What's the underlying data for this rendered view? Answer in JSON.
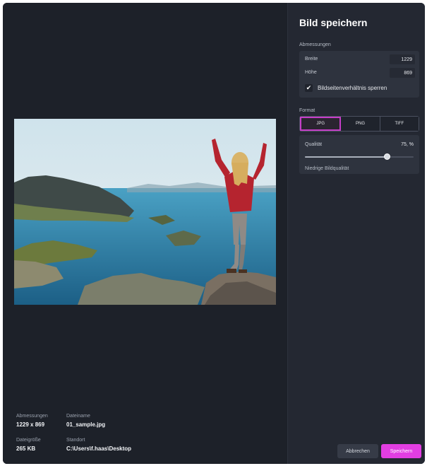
{
  "preview": {
    "image_alt": "Woman with raised arms standing on a rock above a coastal fjord landscape",
    "meta": {
      "dimensions_label": "Abmessungen",
      "dimensions_value": "1229 x 869",
      "filename_label": "Dateiname",
      "filename_value": "01_sample.jpg",
      "filesize_label": "Dateigröße",
      "filesize_value": "265 KB",
      "location_label": "Standort",
      "location_value": "C:\\Users\\f.haas\\Desktop"
    }
  },
  "panel": {
    "title": "Bild speichern",
    "dimensions": {
      "section_label": "Abmessungen",
      "width_label": "Breite",
      "width_value": "1229",
      "height_label": "Höhe",
      "height_value": "869",
      "lock_label": "Bildseitenverhältnis sperren",
      "lock_checked": true
    },
    "format": {
      "section_label": "Format",
      "options": [
        "JPG",
        "PNG",
        "TIFF"
      ],
      "selected": "JPG",
      "quality_label": "Qualität",
      "quality_value": "75, %",
      "quality_level": 0.75,
      "quality_hint": "Niedrige Bildqualität"
    },
    "buttons": {
      "cancel": "Abbrechen",
      "save": "Speichern"
    }
  },
  "colors": {
    "background": "#1d2129",
    "panel": "#242832",
    "accent": "#e23ee2",
    "selected_outline": "#c63ec8"
  }
}
